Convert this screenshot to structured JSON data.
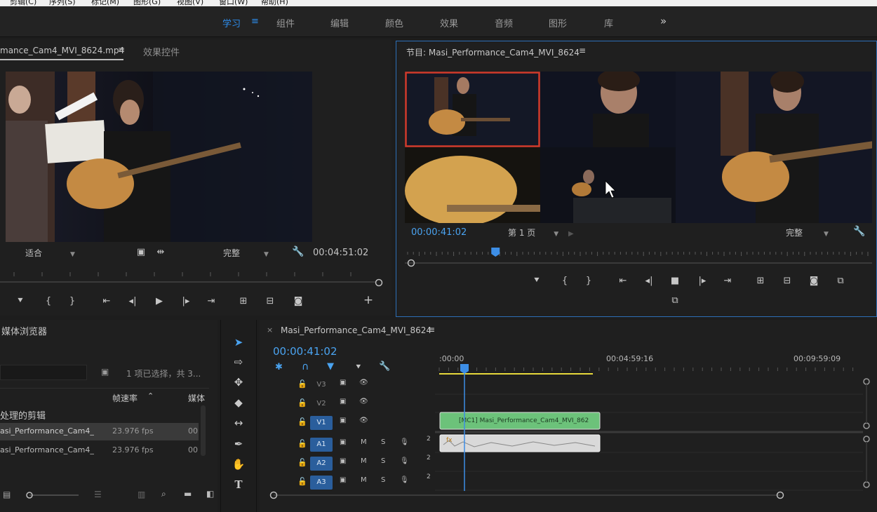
{
  "menubar": {
    "items": [
      "剪辑(C)",
      "序列(S)",
      "标记(M)",
      "图形(G)",
      "视图(V)",
      "窗口(W)",
      "帮助(H)"
    ]
  },
  "workspaces": {
    "items": [
      "学习",
      "组件",
      "编辑",
      "颜色",
      "效果",
      "音频",
      "图形",
      "库"
    ],
    "active": "学习",
    "more": "»"
  },
  "source_panel": {
    "tab_clip": "mance_Cam4_MVI_8624.mp4",
    "tab_effects": "效果控件",
    "fit_label": "适合",
    "quality_label": "完整",
    "timecode": "00:04:51:02"
  },
  "program_panel": {
    "title": "节目: Masi_Performance_Cam4_MVI_8624",
    "timecode": "00:00:41:02",
    "page_label": "第 1 页",
    "quality_label": "完整",
    "playhead_fraction": 0.185
  },
  "media_browser": {
    "title": "媒体浏览器",
    "selection_info": "1 项已选择，共 3...",
    "col_framerate": "帧速率",
    "col_media": "媒体",
    "group_label": "处理的剪辑",
    "rows": [
      {
        "name": "asi_Performance_Cam4_",
        "fps": "23.976 fps",
        "media": "00"
      },
      {
        "name": "asi_Performance_Cam4_",
        "fps": "23.976 fps",
        "media": "00"
      }
    ]
  },
  "timeline": {
    "sequence_tab": "Masi_Performance_Cam4_MVI_8624",
    "timecode": "00:00:41:02",
    "ruler_labels": [
      ":00:00",
      "00:04:59:16",
      "00:09:59:09"
    ],
    "tracks": [
      {
        "name": "V3",
        "kind": "video",
        "targeted": false
      },
      {
        "name": "V2",
        "kind": "video",
        "targeted": false
      },
      {
        "name": "V1",
        "kind": "video",
        "targeted": true
      },
      {
        "name": "A1",
        "kind": "audio",
        "targeted": true
      },
      {
        "name": "A2",
        "kind": "audio",
        "targeted": true
      },
      {
        "name": "A3",
        "kind": "audio",
        "targeted": true
      }
    ],
    "video_clip_label": "[MC1] Masi_Performance_Cam4_MVI_862",
    "audio_clip_label": "fx",
    "audio_channel": "2",
    "track_m": "M",
    "track_s": "S"
  },
  "colors": {
    "accent": "#2d8ceb",
    "video_clip": "#6cc27a",
    "audio_clip": "#d9d9d9",
    "work_area": "#e6d83b",
    "selection_border": "#d23a2a"
  }
}
